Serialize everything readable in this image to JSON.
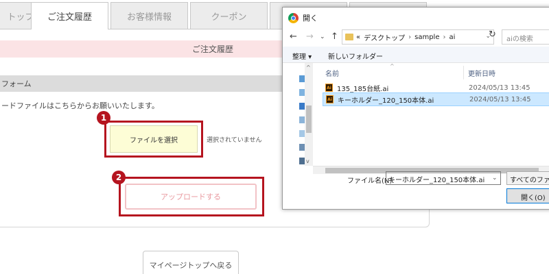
{
  "tabs": [
    {
      "label": "トップ"
    },
    {
      "label": "ご注文履歴"
    },
    {
      "label": "お客様情報"
    },
    {
      "label": "クーポン"
    }
  ],
  "section_title": "ご注文履歴",
  "form": {
    "header": "フォーム",
    "instruction": "ードファイルはこちらからお願いいたします。",
    "file_button_label": "ファイルを選択",
    "no_file_text": "選択されていません",
    "upload_button_label": "アップロードする"
  },
  "badges": [
    "1",
    "2"
  ],
  "mypage_button_label": "マイページトップへ戻る",
  "dialog": {
    "title": "開く",
    "path": [
      "«",
      "デスクトップ",
      "›",
      "sample",
      "›",
      "ai"
    ],
    "search_placeholder": "aiの検索",
    "organize_label": "整理 ▾",
    "new_folder_label": "新しいフォルダー",
    "columns": {
      "name": "名前",
      "modified": "更新日時"
    },
    "files": [
      {
        "name": "135_185台紙.ai",
        "modified": "2024/05/13 13:45",
        "selected": false
      },
      {
        "name": "キーホルダー_120_150本体.ai",
        "modified": "2024/05/13 13:45",
        "selected": true
      }
    ],
    "filename_label": "ファイル名(N):",
    "filename_value": "キーホルダー_120_150本体.ai",
    "filetype_value": "すべてのファイル",
    "open_label": "開く(O)"
  },
  "colors": {
    "accent_red": "#b5141f",
    "pink_bar": "#fbe3e5",
    "file_button_bg": "#fdfdd6",
    "selection_blue": "#cce8ff"
  }
}
